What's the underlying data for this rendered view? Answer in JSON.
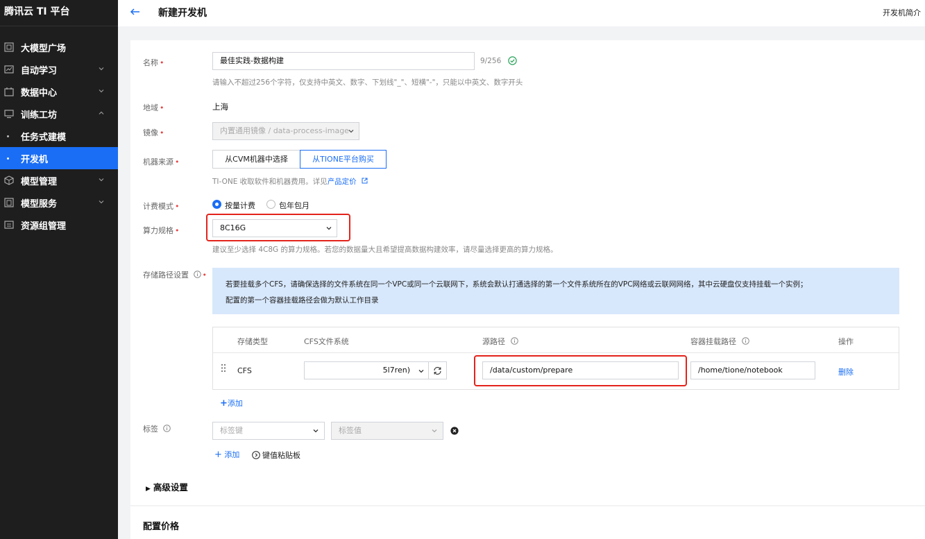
{
  "app": {
    "brand": "腾讯云 TI 平台"
  },
  "sidebar": {
    "items": [
      {
        "label": "大模型广场"
      },
      {
        "label": "自动学习"
      },
      {
        "label": "数据中心"
      },
      {
        "label": "训练工坊"
      },
      {
        "label": "任务式建模"
      },
      {
        "label": "开发机"
      },
      {
        "label": "模型管理"
      },
      {
        "label": "模型服务"
      },
      {
        "label": "资源组管理"
      }
    ]
  },
  "header": {
    "title": "新建开发机",
    "intro_link": "开发机简介"
  },
  "form": {
    "name": {
      "label": "名称",
      "value": "最佳实践-数据构建",
      "count": "9/256",
      "hint": "请输入不超过256个字符，仅支持中英文、数字、下划线\"_\"、短横\"-\"，只能以中英文、数字开头"
    },
    "region": {
      "label": "地域",
      "value": "上海"
    },
    "image": {
      "label": "镜像",
      "value": "内置通用镜像 / data-process-image"
    },
    "machine_source": {
      "label": "机器来源",
      "options": [
        "从CVM机器中选择",
        "从TIONE平台购买"
      ],
      "selected": "从TIONE平台购买",
      "hint_prefix": "TI-ONE 收取软件和机器费用。详见",
      "hint_link": "产品定价"
    },
    "billing": {
      "label": "计费模式",
      "options": [
        "按量计费",
        "包年包月"
      ],
      "selected": "按量计费"
    },
    "spec": {
      "label": "算力规格",
      "value": "8C16G",
      "hint": "建议至少选择 4C8G 的算力规格。若您的数据量大且希望提高数据构建效率，请尽量选择更高的算力规格。"
    },
    "storage": {
      "label": "存储路径设置",
      "info_line1": "若要挂载多个CFS，请确保选择的文件系统在同一个VPC或同一个云联网下，系统会默认打通选择的第一个文件系统所在的VPC网络或云联网网络，其中云硬盘仅支持挂载一个实例；",
      "info_line2": "配置的第一个容器挂载路径会做为默认工作目录",
      "columns": [
        "存储类型",
        "CFS文件系统",
        "源路径",
        "容器挂载路径",
        "操作"
      ],
      "rows": [
        {
          "type": "CFS",
          "cfs": "5l7ren)",
          "source_path": "/data/custom/prepare",
          "mount_path": "/home/tione/notebook",
          "action": "删除"
        }
      ],
      "add_label": "添加"
    },
    "tags": {
      "label": "标签",
      "key_placeholder": "标签键",
      "value_placeholder": "标签值",
      "add_label": "添加",
      "paste_label": "键值粘贴板"
    },
    "advanced": {
      "label": "高级设置"
    }
  },
  "price": {
    "title": "配置价格"
  },
  "colors": {
    "accent": "#1a6ef5",
    "sidebar_bg": "#1e1e1e",
    "highlight_box": "#e3231b",
    "info_bg": "#d8e8fc"
  }
}
